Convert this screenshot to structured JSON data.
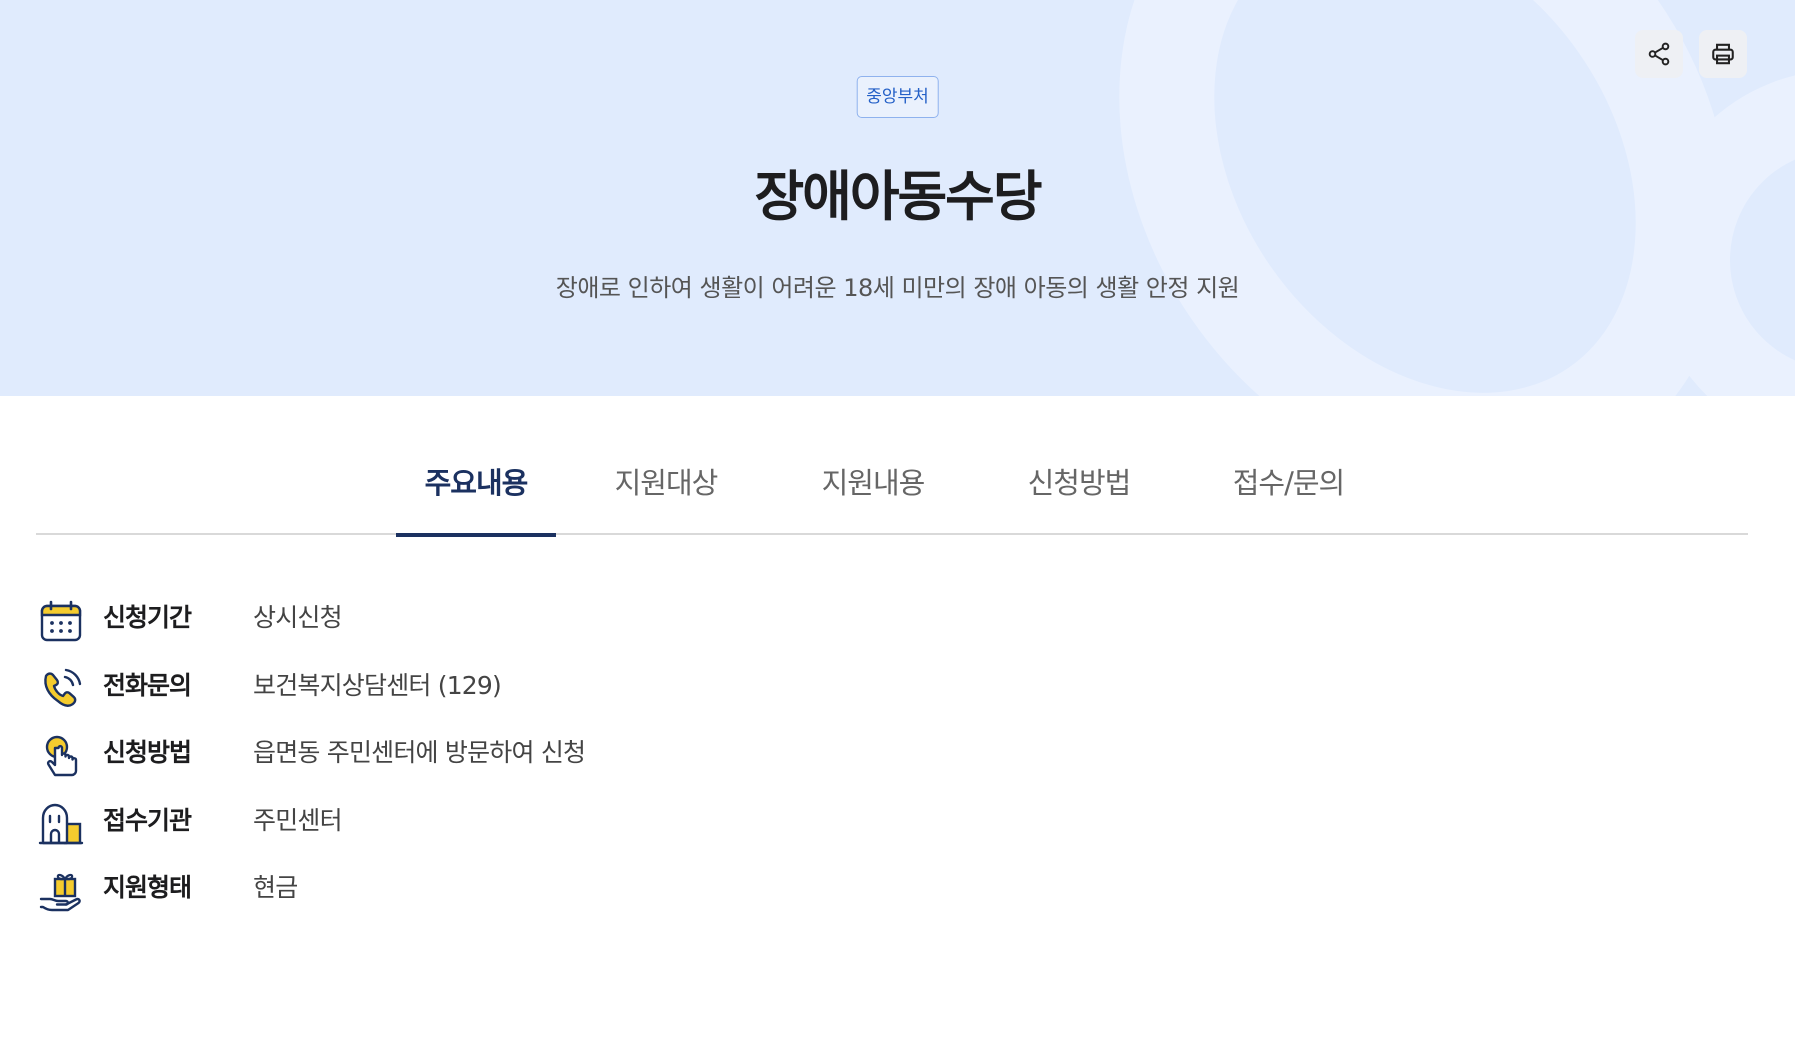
{
  "header": {
    "badge": "중앙부처",
    "title": "장애아동수당",
    "description": "장애로 인하여 생활이 어려운 18세 미만의 장애 아동의 생활 안정 지원",
    "actions": [
      {
        "icon": "share-icon"
      },
      {
        "icon": "print-icon"
      }
    ]
  },
  "tabs": [
    {
      "label": "주요내용",
      "active": true
    },
    {
      "label": "지원대상",
      "active": false
    },
    {
      "label": "지원내용",
      "active": false
    },
    {
      "label": "신청방법",
      "active": false
    },
    {
      "label": "접수/문의",
      "active": false
    }
  ],
  "summary": [
    {
      "icon": "calendar-icon",
      "label": "신청기간",
      "value": "상시신청"
    },
    {
      "icon": "phone-icon",
      "label": "전화문의",
      "value": "보건복지상담센터 (129)"
    },
    {
      "icon": "hand-pointer-icon",
      "label": "신청방법",
      "value": "읍면동 주민센터에 방문하여 신청"
    },
    {
      "icon": "building-icon",
      "label": "접수기관",
      "value": "주민센터"
    },
    {
      "icon": "gift-hand-icon",
      "label": "지원형태",
      "value": "현금"
    }
  ],
  "colors": {
    "hero_background": "#e0ebfd",
    "accent_navy": "#1b3160",
    "badge_text": "#2460c7",
    "icon_yellow": "#f5cc2e"
  }
}
